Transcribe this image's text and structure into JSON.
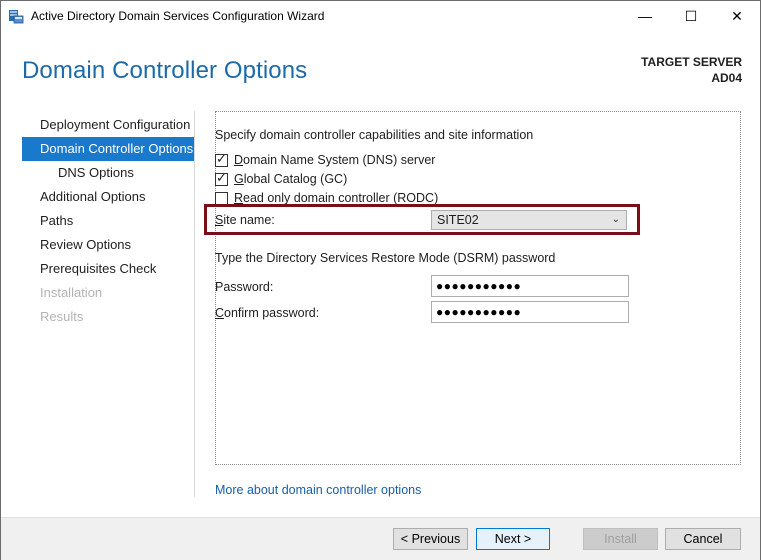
{
  "window": {
    "title": "Active Directory Domain Services Configuration Wizard",
    "minimize_glyph": "—",
    "maximize_glyph": "☐",
    "close_glyph": "✕"
  },
  "header": {
    "page_title": "Domain Controller Options",
    "target_label": "TARGET SERVER",
    "target_name": "AD04"
  },
  "nav": {
    "items": [
      {
        "label": "Deployment Configuration",
        "state": "normal"
      },
      {
        "label": "Domain Controller Options",
        "state": "active"
      },
      {
        "label": "DNS Options",
        "state": "sub"
      },
      {
        "label": "Additional Options",
        "state": "normal"
      },
      {
        "label": "Paths",
        "state": "normal"
      },
      {
        "label": "Review Options",
        "state": "normal"
      },
      {
        "label": "Prerequisites Check",
        "state": "normal"
      },
      {
        "label": "Installation",
        "state": "disabled"
      },
      {
        "label": "Results",
        "state": "disabled"
      }
    ]
  },
  "main": {
    "capabilities_heading": "Specify domain controller capabilities and site information",
    "dns_checkbox": {
      "mnemonic": "D",
      "rest": "omain Name System (DNS) server",
      "checked": true
    },
    "gc_checkbox": {
      "mnemonic": "G",
      "rest": "lobal Catalog (GC)",
      "checked": true
    },
    "rodc_checkbox": {
      "mnemonic": "R",
      "rest": "ead only domain controller (RODC)",
      "checked": false
    },
    "site_label_mnemonic": "S",
    "site_label_rest": "ite name:",
    "site_value": "SITE02",
    "dsrm_heading": "Type the Directory Services Restore Mode (DSRM) password",
    "password_label_pre": "Password",
    "password_label_mnemonic": "",
    "password_label_colon": ":",
    "password_value": "●●●●●●●●●●●",
    "confirm_label_mnemonic": "C",
    "confirm_label_rest": "onfirm password:",
    "confirm_value": "●●●●●●●●●●●",
    "more_link": "More about domain controller options"
  },
  "footer": {
    "previous_label": "< Previous",
    "next_label": "Next >",
    "install_label": "Install",
    "cancel_label": "Cancel"
  }
}
